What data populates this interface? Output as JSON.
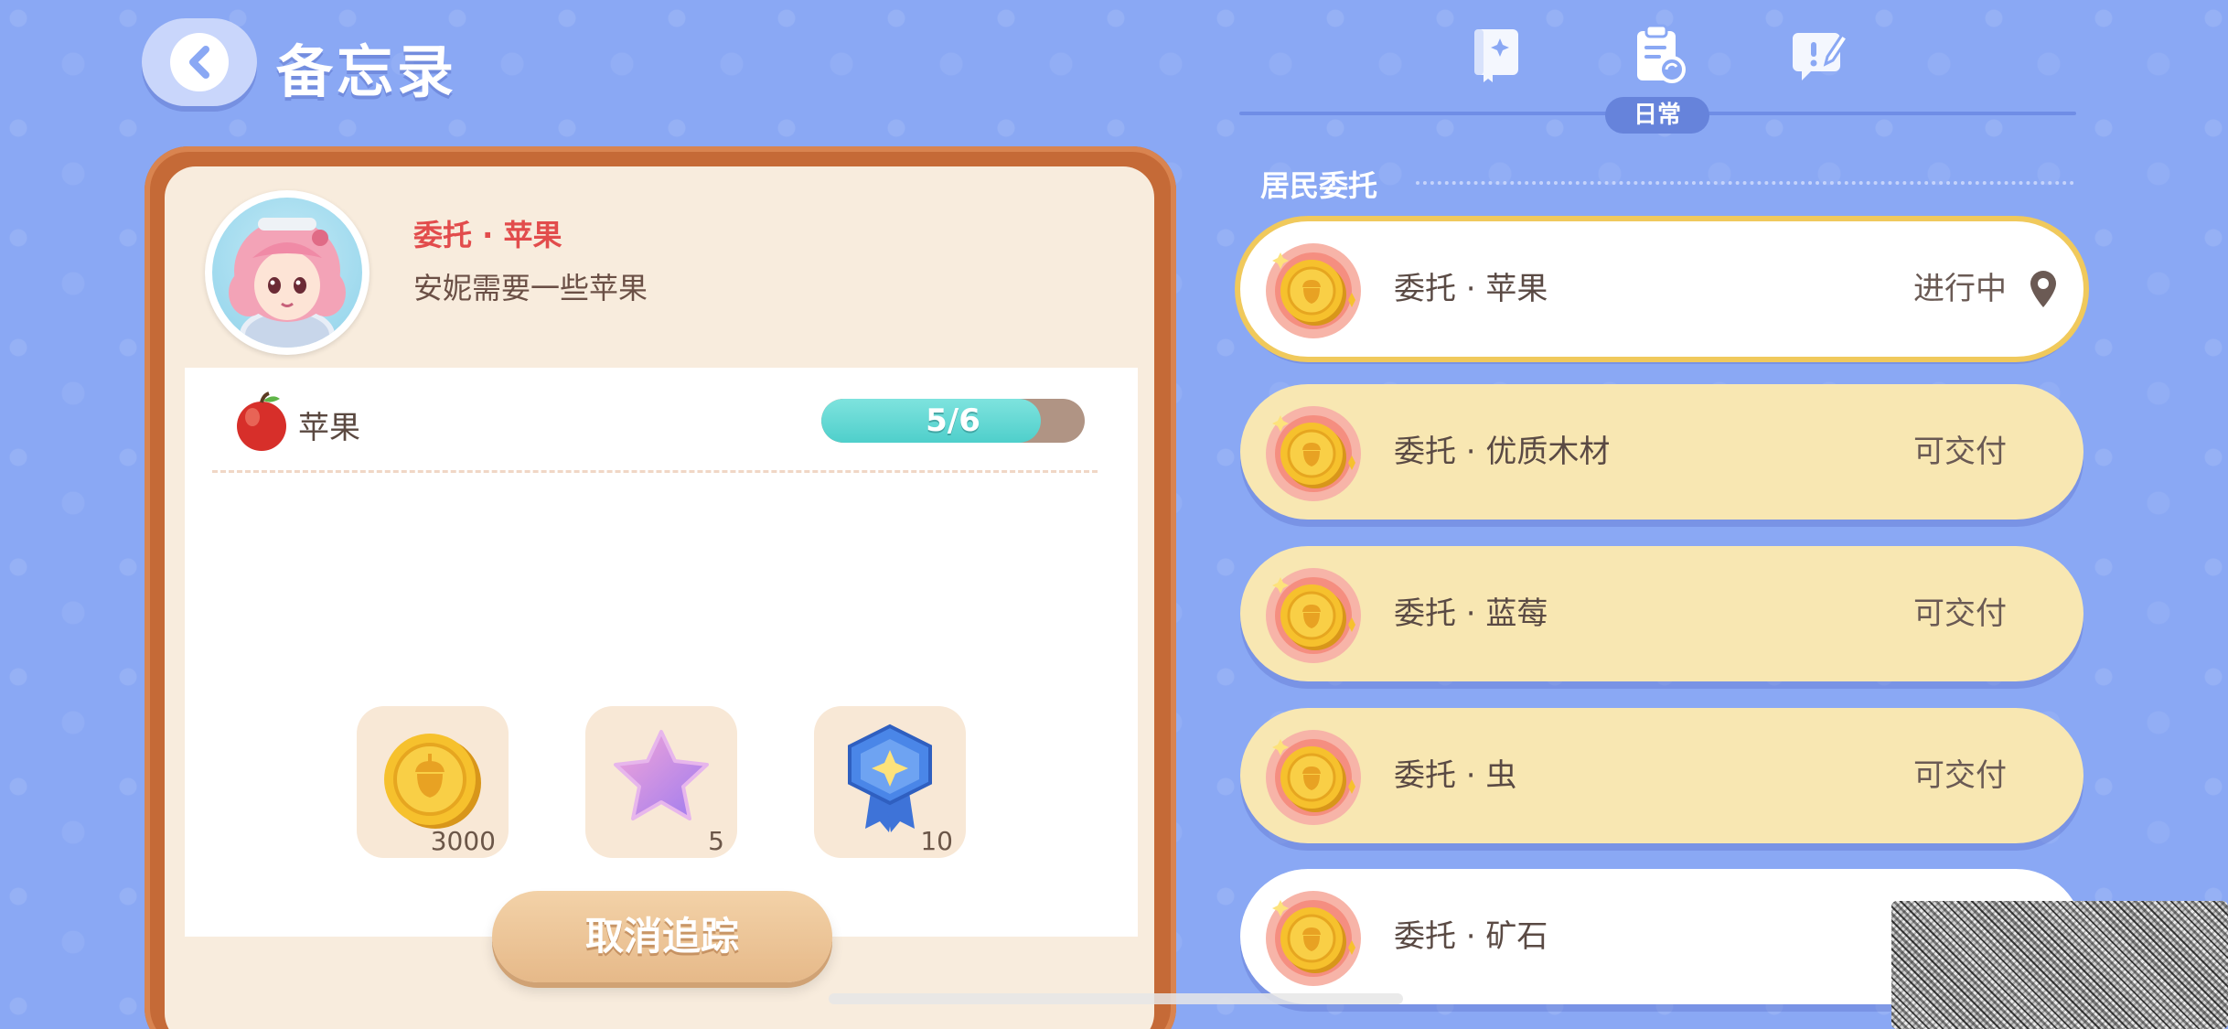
{
  "header": {
    "title": "备忘录"
  },
  "tabs": {
    "active_label": "日常",
    "icons": [
      "book-icon",
      "clipboard-refresh-icon",
      "note-pen-icon"
    ]
  },
  "detail": {
    "quest_title": "委托 · 苹果",
    "quest_desc": "安妮需要一些苹果",
    "requirement": {
      "name": "苹果",
      "progress_text": "5/6",
      "progress_fraction": 0.8333
    },
    "rewards": [
      {
        "icon": "acorn-coin-icon",
        "count": "3000"
      },
      {
        "icon": "star-icon",
        "count": "5"
      },
      {
        "icon": "badge-icon",
        "count": "10"
      }
    ],
    "cancel_label": "取消追踪"
  },
  "list": {
    "section_label": "居民委托",
    "items": [
      {
        "name": "委托 · 苹果",
        "status": "进行中"
      },
      {
        "name": "委托 · 优质木材",
        "status": "可交付"
      },
      {
        "name": "委托 · 蓝莓",
        "status": "可交付"
      },
      {
        "name": "委托 · 虫",
        "status": "可交付"
      },
      {
        "name": "委托 · 矿石",
        "status": ""
      }
    ]
  },
  "colors": {
    "background": "#8aa8f4",
    "frame": "#c56a37",
    "card_yellow": "#f8e7b2",
    "quest_title_red": "#e24c4c",
    "progress_teal": "#4fcfcb"
  }
}
